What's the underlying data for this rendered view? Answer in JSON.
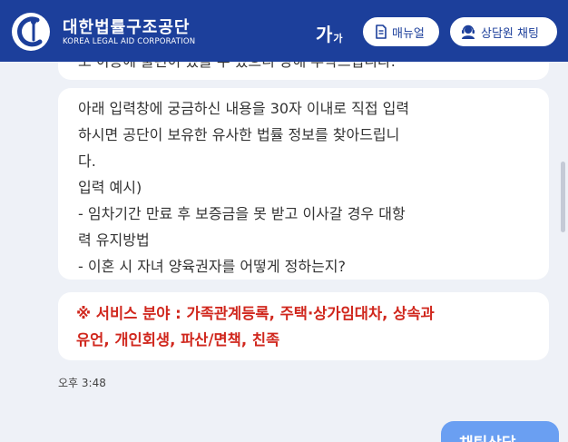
{
  "header": {
    "org_name_ko": "대한법률구조공단",
    "org_name_en": "KOREA LEGAL AID CORPORATION",
    "font_size_big": "가",
    "font_size_small": "가",
    "manual_label": "매뉴얼",
    "counsel_chat_label": "상담원 채팅",
    "brand_color": "#1c3f9b"
  },
  "messages": {
    "previous_cut": "도 이용에 불편이 있을 수 있으니 양해 부탁드립니다.",
    "main_lines": [
      "아래 입력창에 궁금하신 내용을 30자 이내로 직접 입력",
      "하시면 공단이 보유한 유사한 법률 정보를 찾아드립니",
      "다.",
      "입력 예시)",
      "- 임차기간 만료 후 보증금을 못 받고 이사갈 경우 대항",
      "력 유지방법",
      "- 이혼 시 자녀 양육권자를 어떻게 정하는지?"
    ],
    "service_lines": [
      "※ 서비스 분야 : 가족관계등록, 주택·상가임대차, 상속과",
      "유언, 개인회생, 파산/면책, 친족"
    ],
    "service_color": "#d0271d",
    "timestamp": "오후 3:48"
  },
  "chat_button": {
    "label": "채팅상담"
  }
}
